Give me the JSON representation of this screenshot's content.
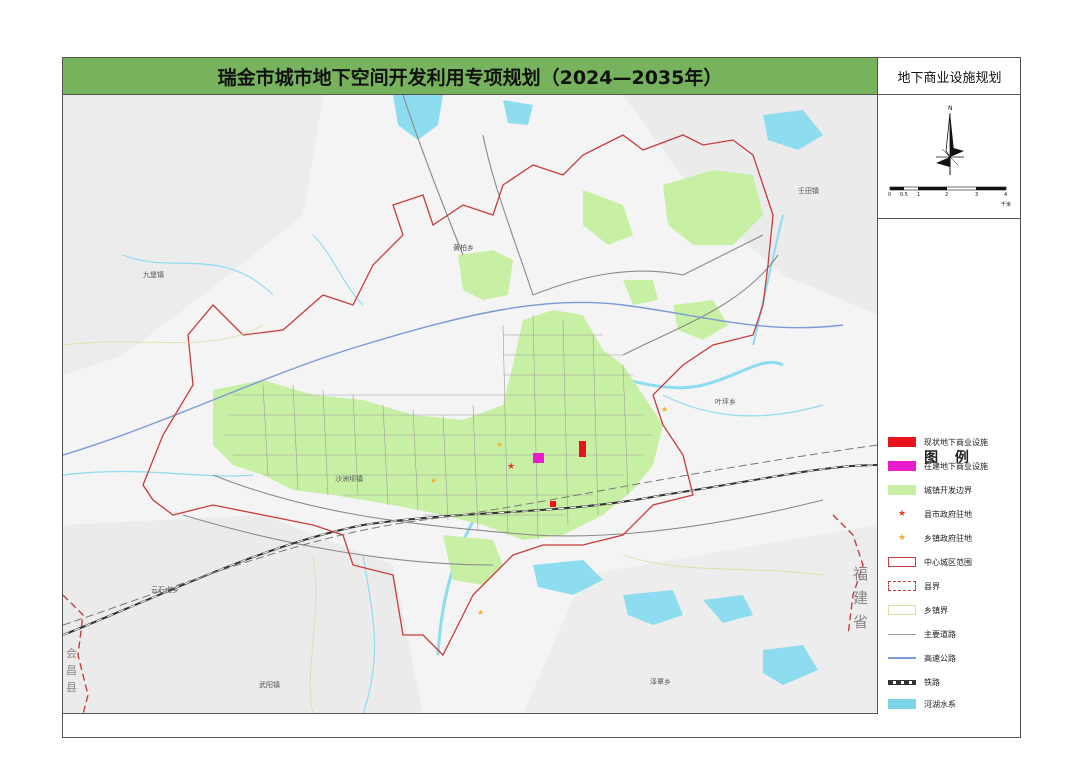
{
  "title": "瑞金市城市地下空间开发利用专项规划（2024—2035年）",
  "subtitle": "地下商业设施规划",
  "north_arrow": {
    "label": "N"
  },
  "scale_bar": {
    "ticks": [
      "0",
      "0.5",
      "1",
      "2",
      "3",
      "4"
    ],
    "unit": "千米"
  },
  "legend": {
    "title": "图 例",
    "items": [
      {
        "label": "现状地下商业设施",
        "color": "#e8141c",
        "symbol": "fill-rect"
      },
      {
        "label": "在建地下商业设施",
        "color": "#e81ccd",
        "symbol": "fill-rect"
      },
      {
        "label": "城镇开发边界",
        "color": "#c8f0a4",
        "symbol": "fill-rect"
      },
      {
        "label": "县市政府驻地",
        "color": "#e0401c",
        "symbol": "star"
      },
      {
        "label": "乡镇政府驻地",
        "color": "#f0b030",
        "symbol": "star"
      },
      {
        "label": "中心城区范围",
        "color": "#c83c3c",
        "symbol": "outline-rect"
      },
      {
        "label": "县界",
        "color": "#c83c3c",
        "symbol": "dashed-rect"
      },
      {
        "label": "乡镇界",
        "color": "#d8e0a0",
        "symbol": "thin-outline"
      },
      {
        "label": "主要道路",
        "color": "#9a9a9a",
        "symbol": "line"
      },
      {
        "label": "高速公路",
        "color": "#7a9ad8",
        "symbol": "line"
      },
      {
        "label": "铁路",
        "color": "#333333",
        "symbol": "rail"
      },
      {
        "label": "河湖水系",
        "color": "#7dd6e8",
        "symbol": "fill-rect"
      }
    ]
  },
  "map_labels": {
    "jiubao": "九堡镇",
    "huangbai": "黄柏乡",
    "shatian": "壬田镇",
    "yeping": "叶坪乡",
    "yunshishan": "云石山乡",
    "zeqiao": "泽覃乡",
    "wuyang": "武阳镇",
    "shazhouba": "沙洲坝镇",
    "huichang": "会昌县",
    "fujian": "福建省"
  }
}
